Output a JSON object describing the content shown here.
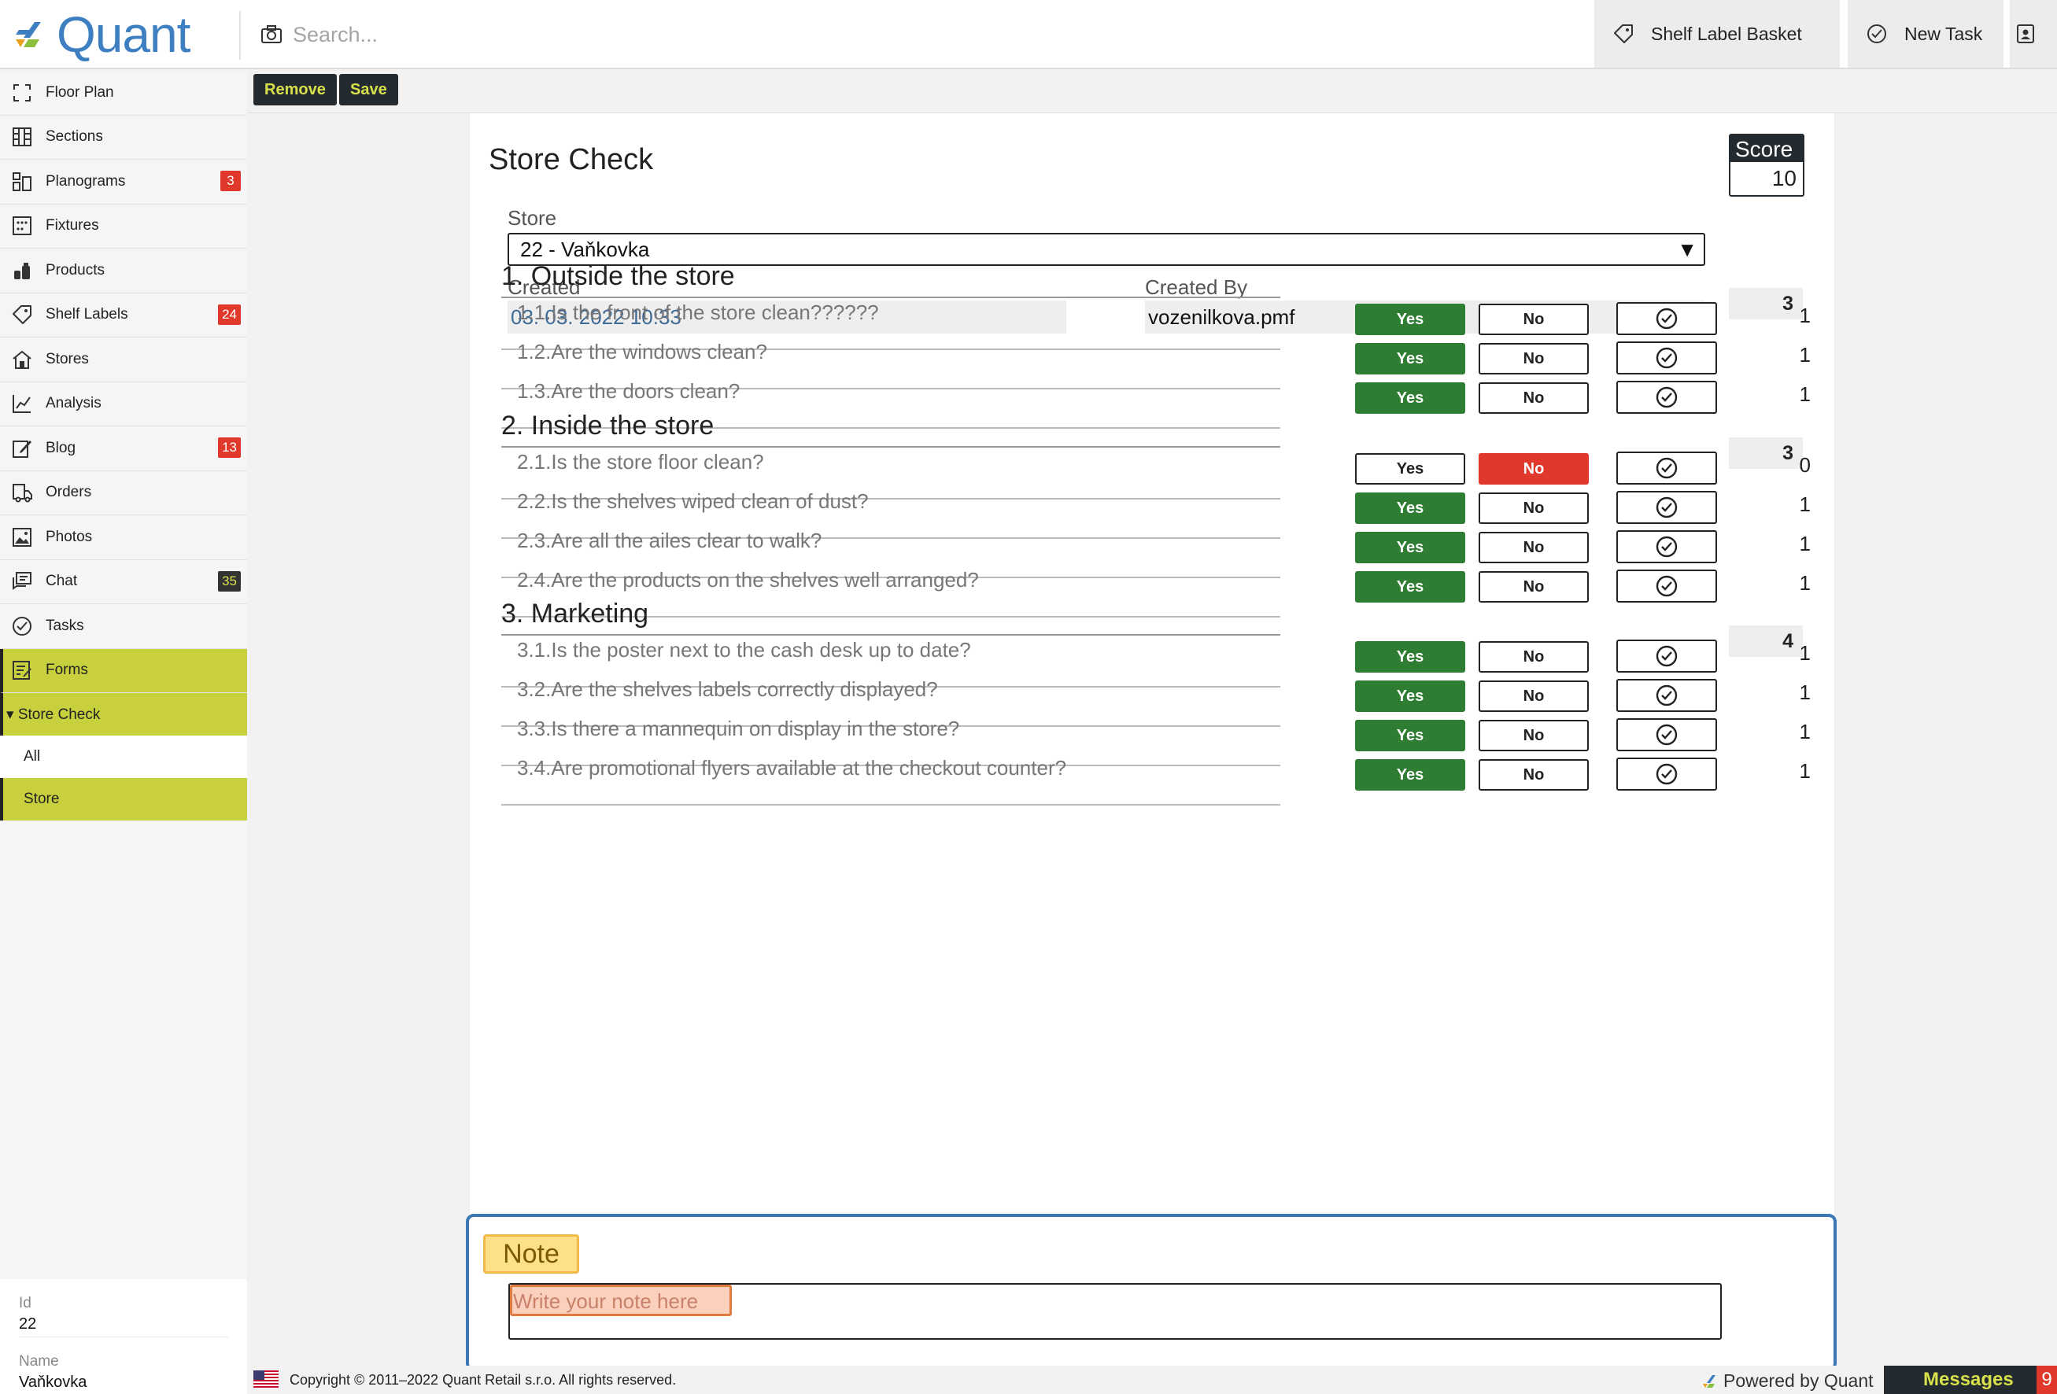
{
  "app": {
    "logo_text": "Quant",
    "search_placeholder": "Search...",
    "shelf_label_basket": "Shelf Label Basket",
    "new_task": "New Task"
  },
  "sidebar": {
    "items": [
      {
        "label": "Floor Plan",
        "icon": "floor-plan-icon",
        "badge": ""
      },
      {
        "label": "Sections",
        "icon": "sections-icon",
        "badge": ""
      },
      {
        "label": "Planograms",
        "icon": "planograms-icon",
        "badge": "3"
      },
      {
        "label": "Fixtures",
        "icon": "fixtures-icon",
        "badge": ""
      },
      {
        "label": "Products",
        "icon": "products-icon",
        "badge": ""
      },
      {
        "label": "Shelf Labels",
        "icon": "tag-icon",
        "badge": "24"
      },
      {
        "label": "Stores",
        "icon": "store-icon",
        "badge": ""
      },
      {
        "label": "Analysis",
        "icon": "analysis-icon",
        "badge": ""
      },
      {
        "label": "Blog",
        "icon": "blog-icon",
        "badge": "13"
      },
      {
        "label": "Orders",
        "icon": "orders-icon",
        "badge": ""
      },
      {
        "label": "Photos",
        "icon": "photos-icon",
        "badge": ""
      },
      {
        "label": "Chat",
        "icon": "chat-icon",
        "badge": "35"
      },
      {
        "label": "Tasks",
        "icon": "tasks-icon",
        "badge": ""
      },
      {
        "label": "Forms",
        "icon": "forms-icon",
        "badge": ""
      }
    ],
    "submenu_title": "▾ Store Check",
    "submenu_items": [
      "All",
      "Store"
    ],
    "info": {
      "id_label": "Id",
      "id_value": "22",
      "name_label": "Name",
      "name_value": "Vaňkovka"
    }
  },
  "toolbar": {
    "remove_label": "Remove",
    "save_label": "Save"
  },
  "form": {
    "title": "Store Check",
    "score_label": "Score",
    "score_value": "10",
    "store_label": "Store",
    "store_value": "22 - Vaňkovka",
    "created_label": "Created",
    "created_value": "03. 03. 2022 10:33",
    "created_by_label": "Created By",
    "created_by_value": "vozenilkova.pmf",
    "yes_label": "Yes",
    "no_label": "No",
    "sections": [
      {
        "title": "1. Outside the store",
        "score": "3",
        "questions": [
          {
            "text": "1.1.Is the front of the store clean??????",
            "answer": "yes",
            "score": "1"
          },
          {
            "text": "1.2.Are the windows clean?",
            "answer": "yes",
            "score": "1"
          },
          {
            "text": "1.3.Are the doors clean?",
            "answer": "yes",
            "score": "1"
          }
        ]
      },
      {
        "title": "2. Inside the store",
        "score": "3",
        "questions": [
          {
            "text": "2.1.Is the store floor clean?",
            "answer": "no",
            "score": "0"
          },
          {
            "text": "2.2.Is the shelves wiped clean of dust?",
            "answer": "yes",
            "score": "1"
          },
          {
            "text": "2.3.Are all the ailes clear to walk?",
            "answer": "yes",
            "score": "1"
          },
          {
            "text": "2.4.Are the products on the shelves well arranged?",
            "answer": "yes",
            "score": "1"
          }
        ]
      },
      {
        "title": "3. Marketing",
        "score": "4",
        "questions": [
          {
            "text": "3.1.Is the poster next to the cash desk up to date?",
            "answer": "yes",
            "score": "1"
          },
          {
            "text": "3.2.Are the shelves labels correctly displayed?",
            "answer": "yes",
            "score": "1"
          },
          {
            "text": "3.3.Is there a mannequin on display in the store?",
            "answer": "yes",
            "score": "1"
          },
          {
            "text": "3.4.Are promotional flyers available at the checkout counter?",
            "answer": "yes",
            "score": "1"
          }
        ]
      }
    ],
    "note_label": "Note",
    "note_placeholder": "Write your note here"
  },
  "footer": {
    "copyright": "Copyright © 2011–2022 Quant Retail s.r.o. All rights reserved.",
    "powered_by": "Powered by Quant",
    "messages_label": "Messages",
    "messages_count": "9"
  },
  "colors": {
    "brand_blue": "#3e7fc1",
    "accent_lime": "#c8d13d",
    "dark": "#232b31",
    "yes_green": "#2e7d32",
    "no_red": "#e0392b"
  }
}
